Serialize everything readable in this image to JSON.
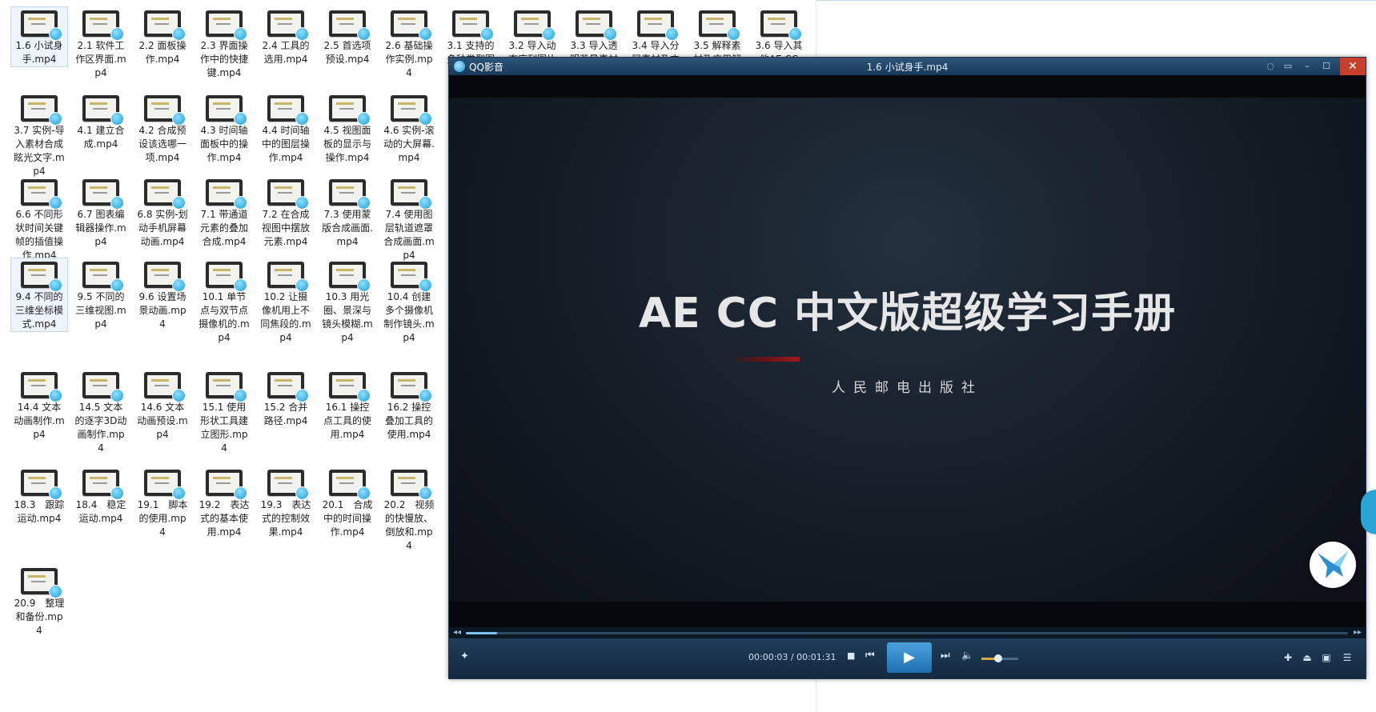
{
  "explorer": {
    "files": [
      "1.6 小试身手.mp4",
      "2.1 软件工作区界面.mp4",
      "2.2 面板操作.mp4",
      "2.3 界面操作中的快捷键.mp4",
      "2.4 工具的选用.mp4",
      "2.5 首选项预设.mp4",
      "2.6 基础操作实例.mp4",
      "3.1 支持的多种类型图",
      "3.2 导入动态序列图片",
      "3.3 导入透明背景素材",
      "3.4 导入分层素材及方",
      "3.5 解释素材及应用解",
      "3.6 导入其他AE CC",
      "3.7 实例-导入素材合成眩光文字.mp4",
      "4.1 建立合成.mp4",
      "4.2 合成预设该选哪一项.mp4",
      "4.3 时间轴面板中的操作.mp4",
      "4.4 时间轴中的图层操作.mp4",
      "4.5 视图面板的显示与操作.mp4",
      "4.6 实例-滚动的大屏幕.mp4",
      "6.6 不同形状时间关键帧的插值操作.mp4",
      "6.7 图表编辑器操作.mp4",
      "6.8 实例-划动手机屏幕动画.mp4",
      "7.1 带通道元素的叠加合成.mp4",
      "7.2 在合成视图中摆放元素.mp4",
      "7.3 使用蒙版合成画面.mp4",
      "7.4 使用图层轨道遮罩合成画面.mp4",
      "9.4 不同的三维坐标模式.mp4",
      "9.5 不同的三维视图.mp4",
      "9.6 设置场景动画.mp4",
      "10.1 单节点与双节点摄像机的.mp4",
      "10.2 让摄像机用上不同焦段的.mp4",
      "10.3 用光圈、景深与镜头模糊.mp4",
      "10.4 创建多个摄像机制作镜头.mp4",
      "14.4 文本动画制作.mp4",
      "14.5 文本的逐字3D动画制作.mp4",
      "14.6 文本动画预设.mp4",
      "15.1 使用形状工具建立图形.mp4",
      "15.2 合并路径.mp4",
      "16.1 操控点工具的使用.mp4",
      "16.2 操控叠加工具的使用.mp4",
      "18.3　跟踪运动.mp4",
      "18.4　稳定运动.mp4",
      "19.1　脚本的使用.mp4",
      "19.2　表达式的基本使用.mp4",
      "19.3　表达式的控制效果.mp4",
      "20.1　合成中的时间操作.mp4",
      "20.2　视频的快慢放、倒放和.mp4",
      "20.9　整理和备份.mp4"
    ]
  },
  "player": {
    "app_name": "QQ影音",
    "video_title": "1.6 小试身手.mp4",
    "frame_title": "AE CC 中文版超级学习手册",
    "frame_publisher": "人民邮电出版社",
    "time_display": "00:00:03 / 00:01:31",
    "progress": 0.035,
    "volume": 0.45,
    "icons": {
      "chat": "chat-bubble-icon",
      "mini": "mini-mode-icon",
      "min": "minimize-icon",
      "max": "maximize-icon",
      "close": "close-icon",
      "seek_back": "rewind-icon",
      "seek_fwd": "fast-forward-icon",
      "effects": "effects-icon",
      "stop": "stop-icon",
      "prev": "previous-icon",
      "play": "play-icon",
      "next": "next-icon",
      "volume": "volume-icon",
      "tools": "toolbox-icon",
      "eject": "eject-icon",
      "screen": "screen-icon",
      "playlist": "playlist-icon"
    },
    "symbols": {
      "close": "✕",
      "max": "☐",
      "min": "–",
      "mini": "▭",
      "chat": "◌",
      "rew": "◂◂",
      "ffw": "▸▸",
      "play": "▶",
      "stop": "■",
      "prev": "⏮",
      "next": "⏭",
      "vol": "🔈",
      "eject": "⏏",
      "list": "☰",
      "tools": "✚",
      "screen": "▣",
      "effects": "✦"
    }
  }
}
